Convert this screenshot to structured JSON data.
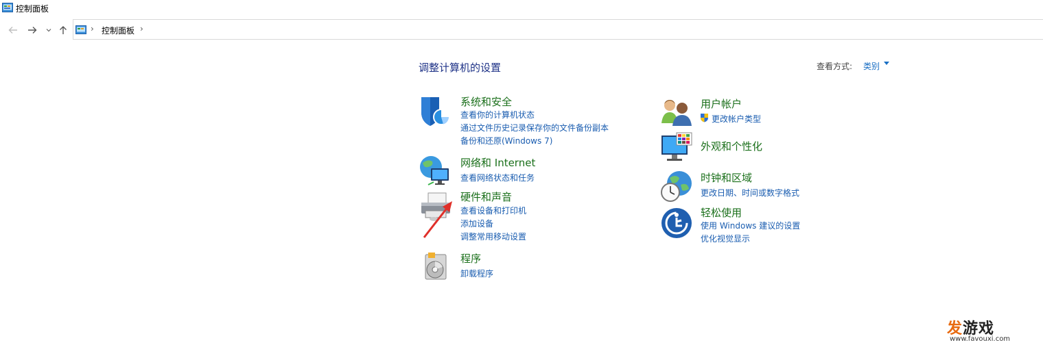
{
  "window": {
    "title": "控制面板"
  },
  "nav": {
    "address_crumb": "控制面板",
    "sep": "›",
    "back_icon": "arrow-left-icon",
    "forward_icon": "arrow-right-icon",
    "up_icon": "arrow-up-icon"
  },
  "main": {
    "heading": "调整计算机的设置",
    "view_by_label": "查看方式:",
    "view_by_value": "类别"
  },
  "categories": {
    "system": {
      "title": "系统和安全",
      "links": [
        "查看你的计算机状态",
        "通过文件历史记录保存你的文件备份副本",
        "备份和还原(Windows 7)"
      ]
    },
    "network": {
      "title": "网络和 Internet",
      "links": [
        "查看网络状态和任务"
      ]
    },
    "hardware": {
      "title": "硬件和声音",
      "links": [
        "查看设备和打印机",
        "添加设备",
        "调整常用移动设置"
      ]
    },
    "programs": {
      "title": "程序",
      "links": [
        "卸载程序"
      ]
    },
    "users": {
      "title": "用户帐户",
      "links": [
        "更改帐户类型"
      ]
    },
    "appearance": {
      "title": "外观和个性化",
      "links": []
    },
    "clock": {
      "title": "时钟和区域",
      "links": [
        "更改日期、时间或数字格式"
      ]
    },
    "ease": {
      "title": "轻松使用",
      "links": [
        "使用 Windows 建议的设置",
        "优化视觉显示"
      ]
    }
  },
  "watermark": {
    "brand_fa": "发",
    "brand_rest": "游戏",
    "url": "www.favouxi.com"
  },
  "colors": {
    "heading": "#1e3287",
    "category_title": "#1a6f1a",
    "link": "#1a5db0",
    "annotation_arrow": "#e0302a"
  }
}
